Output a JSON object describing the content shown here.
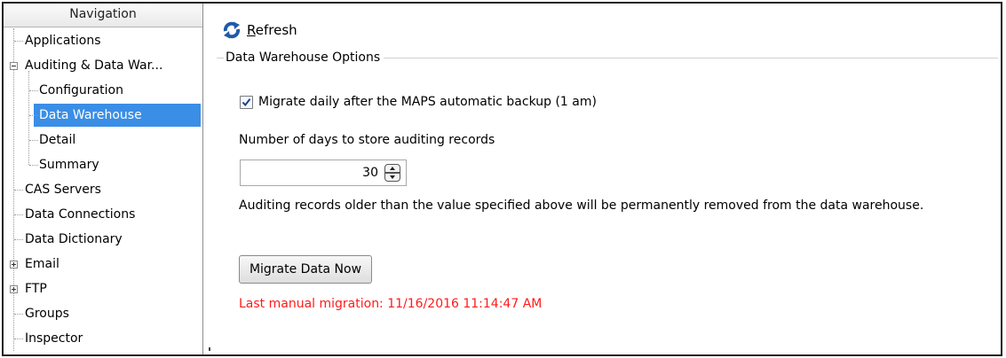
{
  "navigation": {
    "header": "Navigation",
    "items": [
      {
        "label": "Applications",
        "level": 1,
        "expander": ""
      },
      {
        "label": "Auditing & Data War...",
        "level": 1,
        "expander": "minus"
      },
      {
        "label": "Configuration",
        "level": 2,
        "expander": ""
      },
      {
        "label": "Data Warehouse",
        "level": 2,
        "expander": "",
        "selected": true
      },
      {
        "label": "Detail",
        "level": 2,
        "expander": ""
      },
      {
        "label": "Summary",
        "level": 2,
        "expander": ""
      },
      {
        "label": "CAS Servers",
        "level": 1,
        "expander": ""
      },
      {
        "label": "Data Connections",
        "level": 1,
        "expander": ""
      },
      {
        "label": "Data Dictionary",
        "level": 1,
        "expander": ""
      },
      {
        "label": "Email",
        "level": 1,
        "expander": "plus"
      },
      {
        "label": "FTP",
        "level": 1,
        "expander": "plus"
      },
      {
        "label": "Groups",
        "level": 1,
        "expander": ""
      },
      {
        "label": "Inspector",
        "level": 1,
        "expander": ""
      }
    ]
  },
  "toolbar": {
    "refresh_label_underlined": "R",
    "refresh_label_rest": "efresh",
    "refresh_icon": "refresh-icon",
    "accent_color": "#1f5aa8"
  },
  "options": {
    "group_title": "Data Warehouse Options",
    "migrate_daily": {
      "checked": true,
      "label": "Migrate daily after the MAPS automatic backup (1 am)"
    },
    "days_label": "Number of days to store auditing records",
    "days_value": "30",
    "info_text": "Auditing records older than the value specified above will be permanently removed from the data warehouse.",
    "migrate_button": "Migrate Data Now",
    "last_migration": "Last manual migration: 11/16/2016 11:14:47 AM",
    "last_migration_color": "#ff1a1a"
  }
}
